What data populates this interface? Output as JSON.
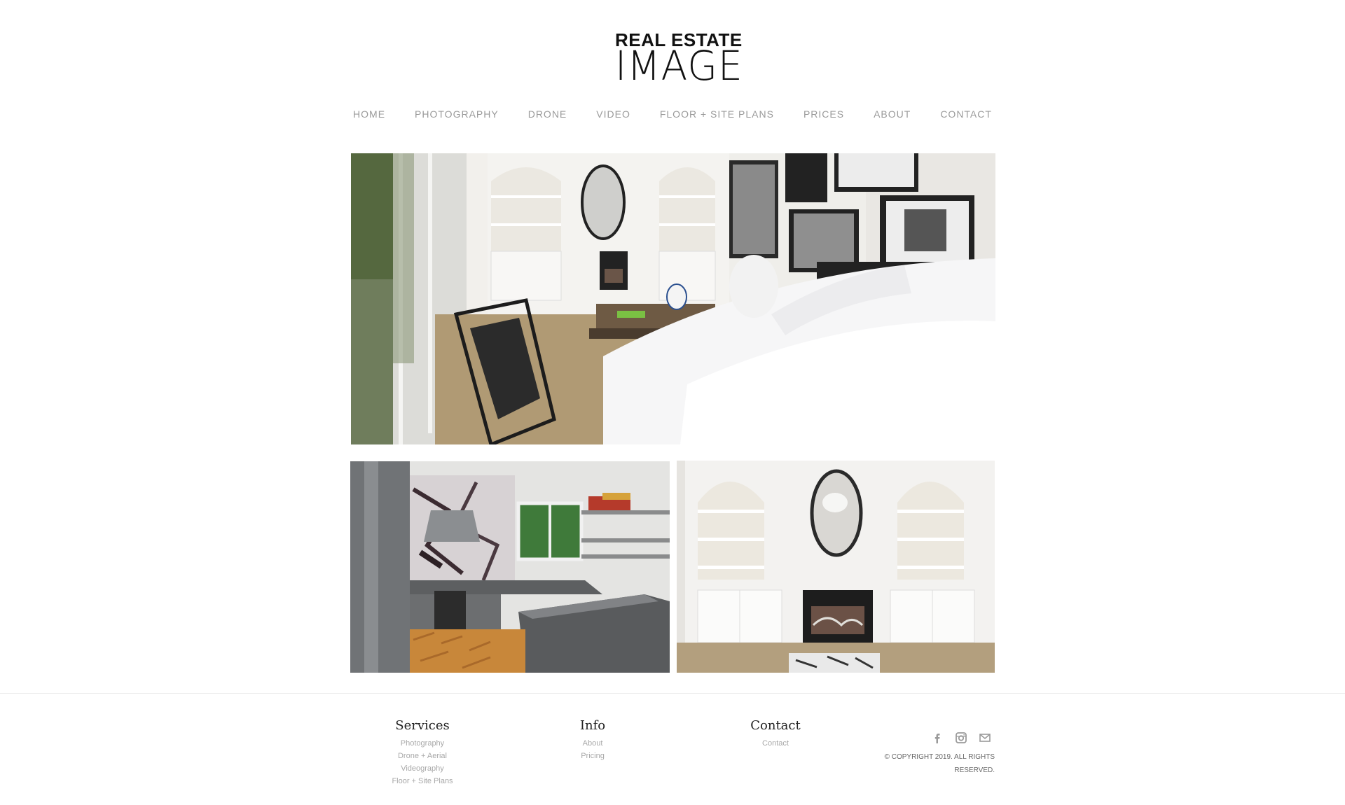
{
  "logo": {
    "line1": "REAL ESTATE",
    "line2": "IMAGE"
  },
  "nav": [
    {
      "label": "HOME"
    },
    {
      "label": "PHOTOGRAPHY"
    },
    {
      "label": "DRONE"
    },
    {
      "label": "VIDEO"
    },
    {
      "label": "FLOOR + SITE PLANS"
    },
    {
      "label": "PRICES"
    },
    {
      "label": "ABOUT"
    },
    {
      "label": "CONTACT"
    }
  ],
  "gallery": [
    {
      "subject": "living room photo"
    },
    {
      "subject": "kitchen photo"
    },
    {
      "subject": "fireplace photo"
    }
  ],
  "footer": {
    "services": {
      "heading": "Services",
      "links": [
        "Photography",
        "Drone + Aerial",
        "Videography",
        "Floor + Site Plans"
      ]
    },
    "info": {
      "heading": "Info",
      "links": [
        "About",
        "Pricing"
      ]
    },
    "contact": {
      "heading": "Contact",
      "links": [
        "Contact"
      ]
    },
    "social": [
      "facebook-icon",
      "instagram-icon",
      "mail-icon"
    ],
    "copyright_line1": "© COPYRIGHT 2019. ALL RIGHTS",
    "copyright_line2": "RESERVED."
  },
  "colors": {
    "nav_text": "#9a9a9a",
    "logo": "#111111",
    "footer_link": "#a8a8a8",
    "rule": "#ececec"
  }
}
